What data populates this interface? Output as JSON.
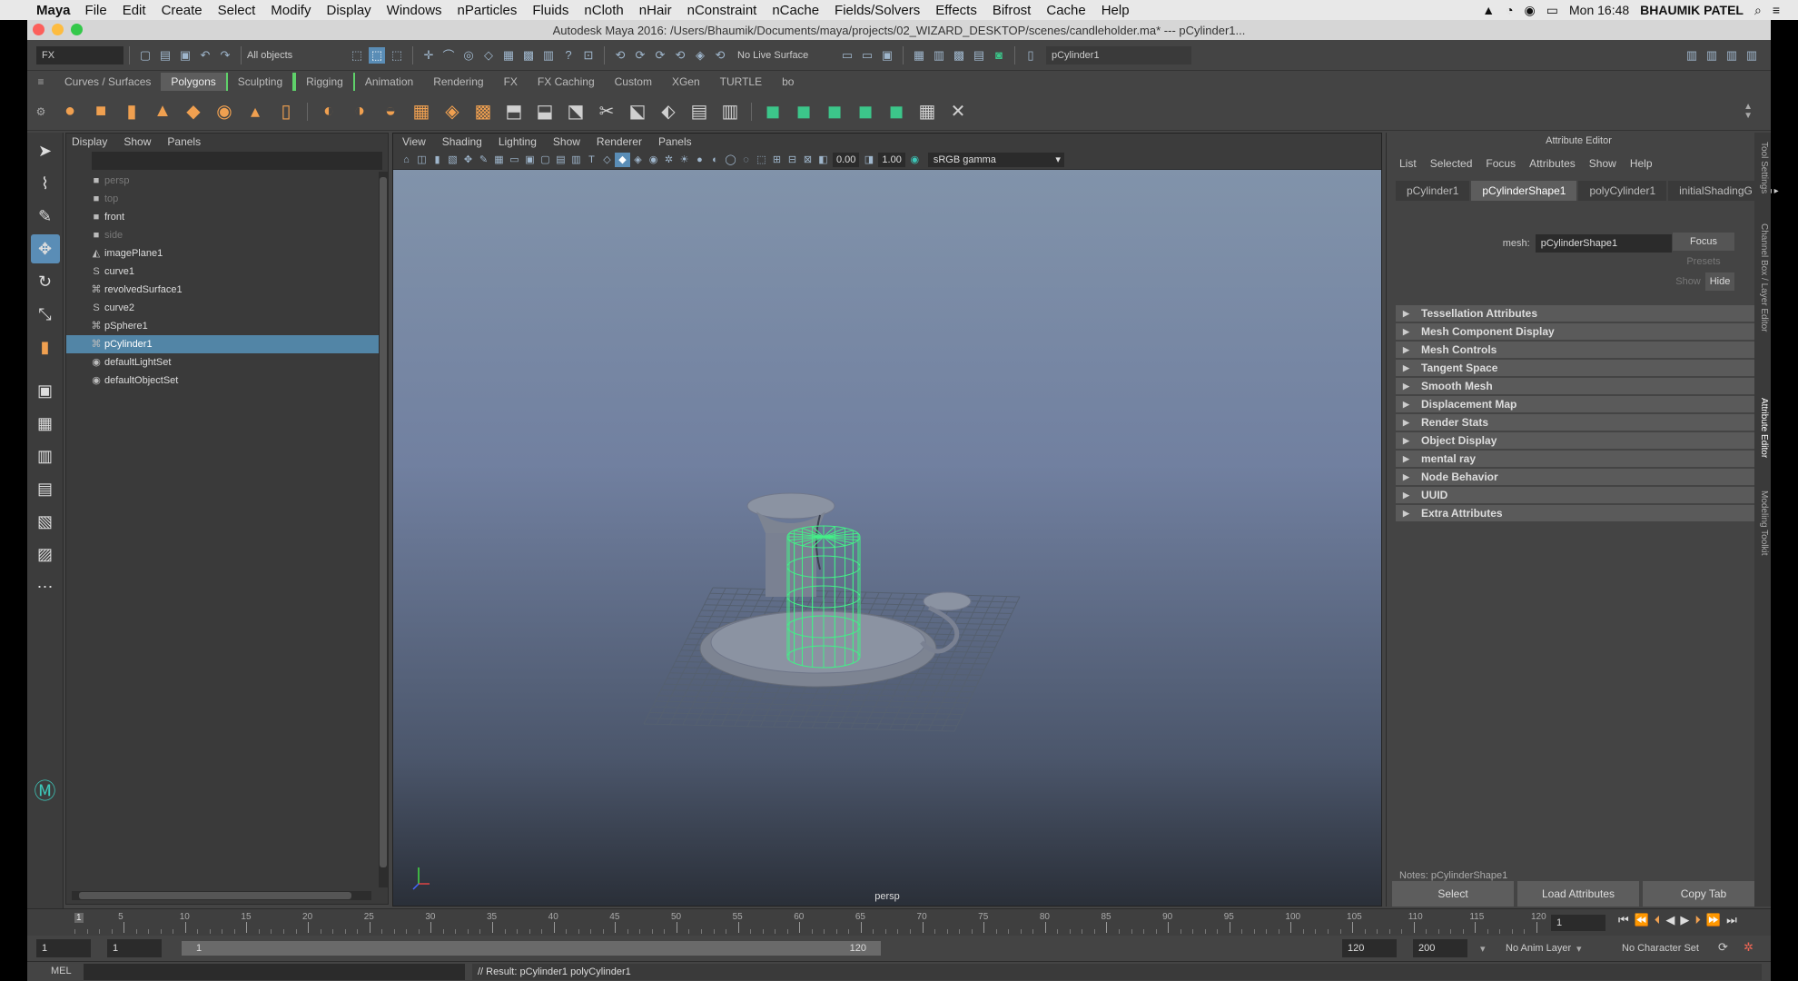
{
  "menubar": {
    "app": "Maya",
    "items": [
      "File",
      "Edit",
      "Create",
      "Select",
      "Modify",
      "Display",
      "Windows",
      "nParticles",
      "Fluids",
      "nCloth",
      "nHair",
      "nConstraint",
      "nCache",
      "Fields/Solvers",
      "Effects",
      "Bifrost",
      "Cache",
      "Help"
    ],
    "clock": "Mon 16:48",
    "user": "BHAUMIK PATEL"
  },
  "window": {
    "title": "Autodesk Maya 2016: /Users/Bhaumik/Documents/maya/projects/02_WIZARD_DESKTOP/scenes/candleholder.ma*  ---  pCylinder1..."
  },
  "statusline": {
    "menuset": "FX",
    "selection_mask": "All objects",
    "live_surface": "No Live Surface",
    "selected_object": "pCylinder1"
  },
  "shelf": {
    "tabs": [
      "Curves / Surfaces",
      "Polygons",
      "Sculpting",
      "Rigging",
      "Animation",
      "Rendering",
      "FX",
      "FX Caching",
      "Custom",
      "XGen",
      "TURTLE",
      "bo"
    ],
    "active_tab": "Polygons"
  },
  "outliner": {
    "menu": [
      "Display",
      "Show",
      "Panels"
    ],
    "items": [
      {
        "label": "persp",
        "icon": "camera-icon",
        "dim": true,
        "selected": false
      },
      {
        "label": "top",
        "icon": "camera-icon",
        "dim": true,
        "selected": false
      },
      {
        "label": "front",
        "icon": "camera-icon",
        "dim": false,
        "selected": false
      },
      {
        "label": "side",
        "icon": "camera-icon",
        "dim": true,
        "selected": false
      },
      {
        "label": "imagePlane1",
        "icon": "image-plane-icon",
        "dim": false,
        "selected": false
      },
      {
        "label": "curve1",
        "icon": "curve-icon",
        "dim": false,
        "selected": false
      },
      {
        "label": "revolvedSurface1",
        "icon": "mesh-icon",
        "dim": false,
        "selected": false
      },
      {
        "label": "curve2",
        "icon": "curve-icon",
        "dim": false,
        "selected": false
      },
      {
        "label": "pSphere1",
        "icon": "mesh-icon",
        "dim": false,
        "selected": false
      },
      {
        "label": "pCylinder1",
        "icon": "mesh-icon",
        "dim": false,
        "selected": true
      },
      {
        "label": "defaultLightSet",
        "icon": "set-icon",
        "dim": false,
        "selected": false
      },
      {
        "label": "defaultObjectSet",
        "icon": "set-icon",
        "dim": false,
        "selected": false
      }
    ]
  },
  "viewport": {
    "menu": [
      "View",
      "Shading",
      "Lighting",
      "Show",
      "Renderer",
      "Panels"
    ],
    "exposure": "0.00",
    "gamma": "1.00",
    "color_space": "sRGB gamma",
    "camera_label": "persp"
  },
  "attribute_editor": {
    "title": "Attribute Editor",
    "menu": [
      "List",
      "Selected",
      "Focus",
      "Attributes",
      "Show",
      "Help"
    ],
    "tabs": [
      "pCylinder1",
      "pCylinderShape1",
      "polyCylinder1",
      "initialShadingG"
    ],
    "active_tab": "pCylinderShape1",
    "mesh_label": "mesh:",
    "mesh_value": "pCylinderShape1",
    "focus_btn": "Focus",
    "presets_btn": "Presets",
    "show_btn": "Show",
    "hide_btn": "Hide",
    "sections": [
      "Tessellation Attributes",
      "Mesh Component Display",
      "Mesh Controls",
      "Tangent Space",
      "Smooth Mesh",
      "Displacement Map",
      "Render Stats",
      "Object Display",
      "mental ray",
      "Node Behavior",
      "UUID",
      "Extra Attributes"
    ],
    "notes": "Notes:  pCylinderShape1",
    "buttons": [
      "Select",
      "Load Attributes",
      "Copy Tab"
    ],
    "side_tabs": [
      "Tool Settings",
      "Channel Box / Layer Editor",
      "Attribute Editor",
      "Modeling Toolkit"
    ]
  },
  "timeslider": {
    "start_label": "1",
    "tick_labels": [
      "5",
      "10",
      "15",
      "20",
      "25",
      "30",
      "35",
      "40",
      "45",
      "50",
      "55",
      "60",
      "65",
      "70",
      "75",
      "80",
      "85",
      "90",
      "95",
      "100",
      "105",
      "110",
      "115",
      "120"
    ],
    "current_frame": "1",
    "range_min": 1,
    "range_max": 120
  },
  "rangeslider": {
    "start": "1",
    "playback_start": "1",
    "range_start_label": "1",
    "range_end_label": "120",
    "playback_end": "120",
    "end": "200",
    "anim_layer": "No Anim Layer",
    "character_set": "No Character Set"
  },
  "cmdline": {
    "lang": "MEL",
    "result": "// Result: pCylinder1 polyCylinder1"
  },
  "colors": {
    "selection": "#5285a6",
    "wireframe_selected": "#44ee88",
    "shelf_accent": "#f0a050"
  }
}
